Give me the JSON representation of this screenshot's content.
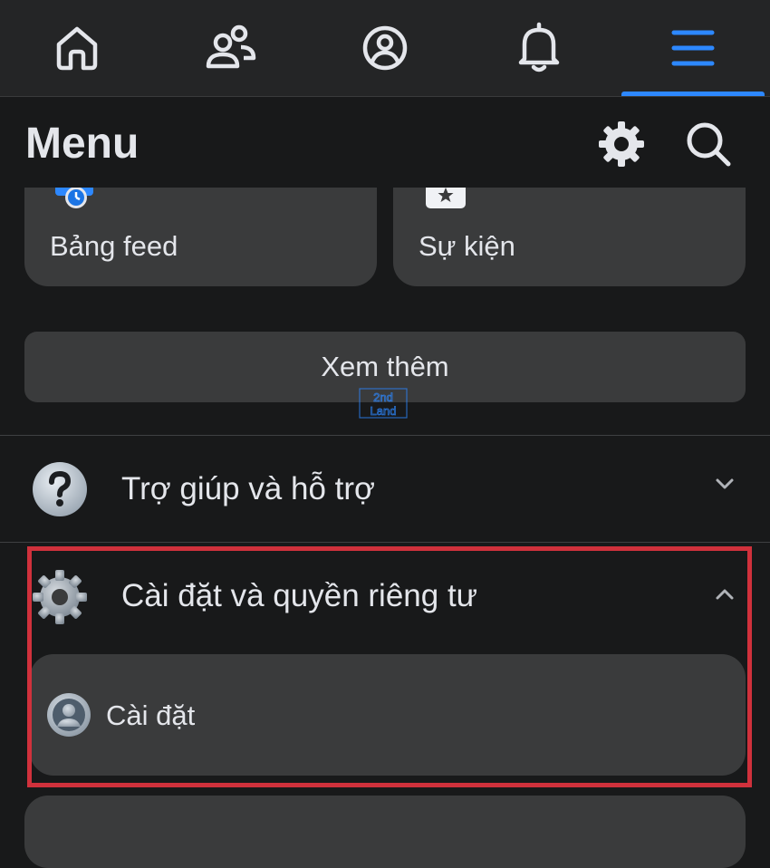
{
  "nav": {
    "tabs": [
      {
        "name": "home",
        "icon": "home-icon"
      },
      {
        "name": "friends",
        "icon": "friends-icon"
      },
      {
        "name": "profile",
        "icon": "profile-icon"
      },
      {
        "name": "notifications",
        "icon": "bell-icon"
      },
      {
        "name": "menu",
        "icon": "hamburger-menu-icon",
        "active": true
      }
    ],
    "active_color": "#2d88ff"
  },
  "header": {
    "title": "Menu",
    "settings_icon": "gear-icon",
    "search_icon": "search-icon"
  },
  "shortcuts": [
    {
      "label": "Bảng feed",
      "icon": "feed-clock-icon"
    },
    {
      "label": "Sự kiện",
      "icon": "calendar-star-icon"
    }
  ],
  "see_more_label": "Xem thêm",
  "watermark": {
    "line1": "2nd",
    "line2": "Land"
  },
  "sections": {
    "help": {
      "label": "Trợ giúp và hỗ trợ",
      "icon": "question-icon",
      "expanded": false
    },
    "settings_privacy": {
      "label": "Cài đặt và quyền riêng tư",
      "icon": "gear-icon",
      "expanded": true,
      "items": [
        {
          "label": "Cài đặt",
          "icon": "profile-circle-icon"
        }
      ]
    }
  },
  "colors": {
    "background": "#18191a",
    "card": "#3a3b3c",
    "text": "#e4e6eb",
    "highlight": "#d0313c"
  }
}
